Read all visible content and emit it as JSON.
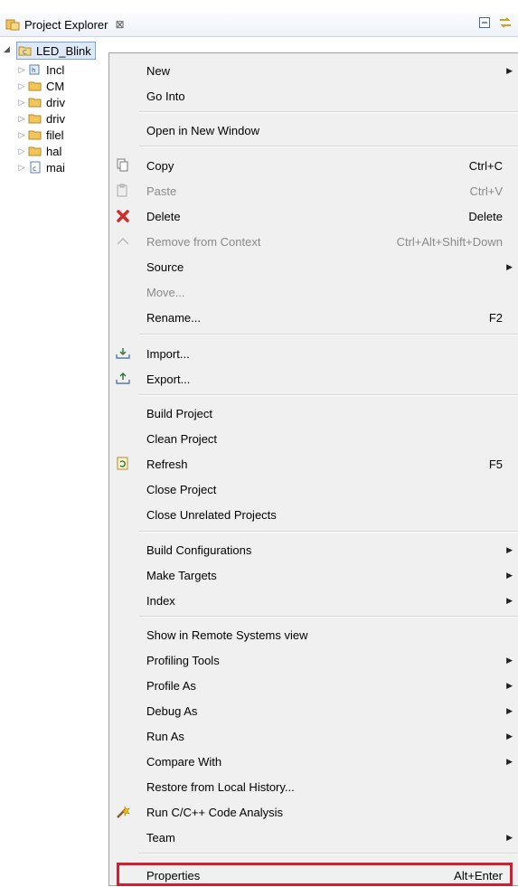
{
  "view": {
    "title": "Project Explorer",
    "close_glyph": "⊠"
  },
  "project": {
    "name": "LED_Blink"
  },
  "tree": [
    {
      "label": "Incl",
      "icon": "includes-icon"
    },
    {
      "label": "CM",
      "icon": "folder-icon"
    },
    {
      "label": "driv",
      "icon": "folder-icon"
    },
    {
      "label": "driv",
      "icon": "folder-icon"
    },
    {
      "label": "filel",
      "icon": "folder-icon"
    },
    {
      "label": "hal",
      "icon": "folder-icon"
    },
    {
      "label": "mai",
      "icon": "c-file-icon"
    }
  ],
  "menu": {
    "new": {
      "label": "New"
    },
    "go_into": {
      "label": "Go Into"
    },
    "open_new_window": {
      "label": "Open in New Window"
    },
    "copy": {
      "label": "Copy",
      "shortcut": "Ctrl+C"
    },
    "paste": {
      "label": "Paste",
      "shortcut": "Ctrl+V"
    },
    "delete": {
      "label": "Delete",
      "shortcut": "Delete"
    },
    "remove_context": {
      "label": "Remove from Context",
      "shortcut": "Ctrl+Alt+Shift+Down"
    },
    "source": {
      "label": "Source"
    },
    "move": {
      "label": "Move..."
    },
    "rename": {
      "label": "Rename...",
      "shortcut": "F2"
    },
    "import": {
      "label": "Import..."
    },
    "export": {
      "label": "Export..."
    },
    "build_project": {
      "label": "Build Project"
    },
    "clean_project": {
      "label": "Clean Project"
    },
    "refresh": {
      "label": "Refresh",
      "shortcut": "F5"
    },
    "close_project": {
      "label": "Close Project"
    },
    "close_unrelated": {
      "label": "Close Unrelated Projects"
    },
    "build_configurations": {
      "label": "Build Configurations"
    },
    "make_targets": {
      "label": "Make Targets"
    },
    "index": {
      "label": "Index"
    },
    "show_remote": {
      "label": "Show in Remote Systems view"
    },
    "profiling_tools": {
      "label": "Profiling Tools"
    },
    "profile_as": {
      "label": "Profile As"
    },
    "debug_as": {
      "label": "Debug As"
    },
    "run_as": {
      "label": "Run As"
    },
    "compare_with": {
      "label": "Compare With"
    },
    "restore_history": {
      "label": "Restore from Local History..."
    },
    "code_analysis": {
      "label": "Run C/C++ Code Analysis"
    },
    "team": {
      "label": "Team"
    },
    "properties": {
      "label": "Properties",
      "shortcut": "Alt+Enter"
    }
  },
  "colors": {
    "highlight_border": "#d0202f",
    "menu_bg": "#f0f0f0"
  }
}
